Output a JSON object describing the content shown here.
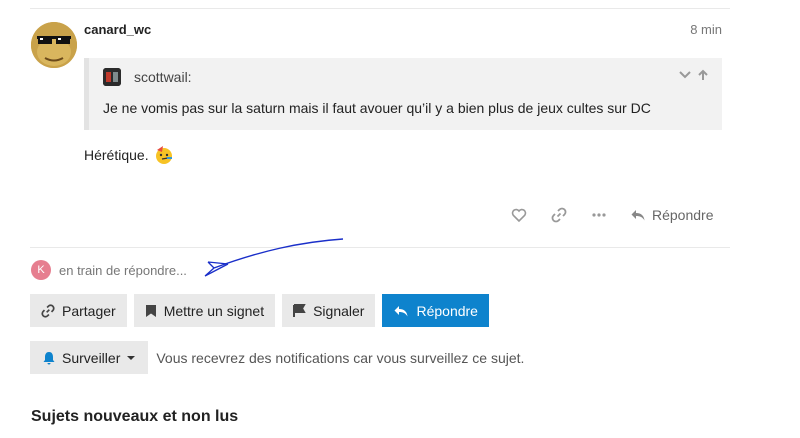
{
  "post": {
    "username": "canard_wc",
    "time": "8 min",
    "quote": {
      "author": "scottwail:",
      "text": "Je ne vomis pas sur la saturn mais il faut avouer qu’il y a bien plus de jeux cultes sur DC"
    },
    "body": "Hérétique.",
    "actions": {
      "reply_label": "Répondre"
    }
  },
  "typing": {
    "avatar_letter": "K",
    "text": "en train de répondre..."
  },
  "buttons": {
    "share": "Partager",
    "bookmark": "Mettre un signet",
    "flag": "Signaler",
    "reply": "Répondre"
  },
  "notifications": {
    "level": "Surveiller",
    "description": "Vous recevrez des notifications car vous surveillez ce sujet."
  },
  "suggested": {
    "title": "Sujets nouveaux et non lus"
  },
  "colors": {
    "primary": "#0e83cd",
    "button_bg": "#e9e9e9",
    "annotation_ink": "#1a2fc9"
  }
}
